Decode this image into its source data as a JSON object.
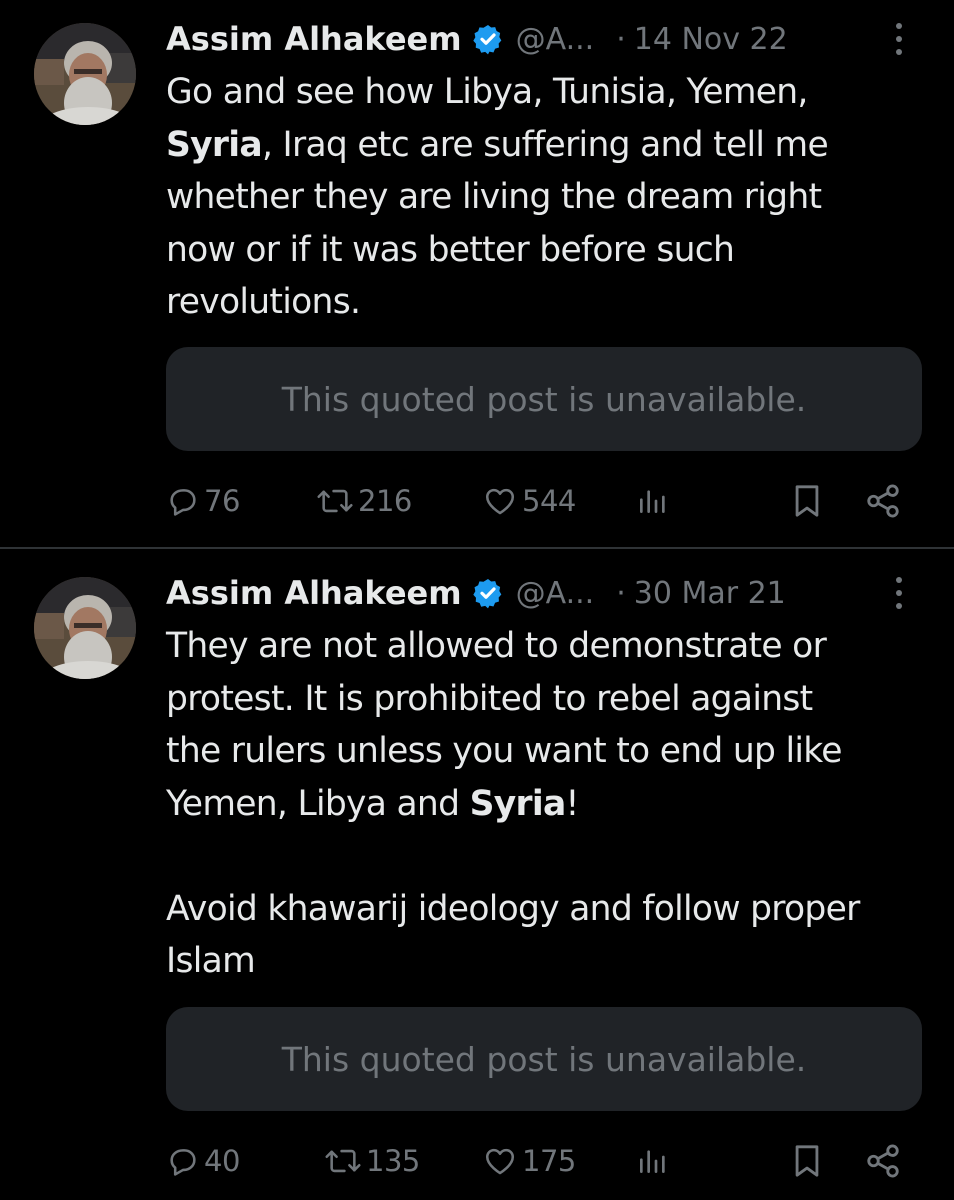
{
  "colors": {
    "background": "#000000",
    "text": "#e7e9ea",
    "muted": "#71767b",
    "verified": "#1d9bf0",
    "quote_bg": "#202327",
    "divider": "#2f3336"
  },
  "tweets": [
    {
      "author": {
        "name": "Assim Alhakeem",
        "handle": "@A...",
        "verified_icon": "verified-badge-icon"
      },
      "separator": "·",
      "date": "14 Nov 22",
      "body": {
        "line1": "Go and see how Libya, Tunisia, Yemen,",
        "bold1": "Syria",
        "line2_rest": ", Iraq etc are suffering and tell me",
        "line3": "whether they are living the dream right",
        "line4": "now or if it was better before such",
        "line5": "revolutions."
      },
      "quote": "This quoted post is unavailable.",
      "metrics": {
        "replies": "76",
        "reposts": "216",
        "likes": "544"
      }
    },
    {
      "author": {
        "name": "Assim Alhakeem",
        "handle": "@A...",
        "verified_icon": "verified-badge-icon"
      },
      "separator": "·",
      "date": "30 Mar 21",
      "body": {
        "line1": "They are not allowed to demonstrate or",
        "line2": "protest. It is prohibited to rebel against",
        "line3": "the rulers unless you want to end up like",
        "line4_pre": "Yemen, Libya and ",
        "bold1": "Syria",
        "line4_post": "!",
        "line5": "Avoid khawarij ideology and follow proper",
        "line6": "Islam"
      },
      "quote": "This quoted post is unavailable.",
      "metrics": {
        "replies": "40",
        "reposts": "135",
        "likes": "175"
      }
    }
  ]
}
